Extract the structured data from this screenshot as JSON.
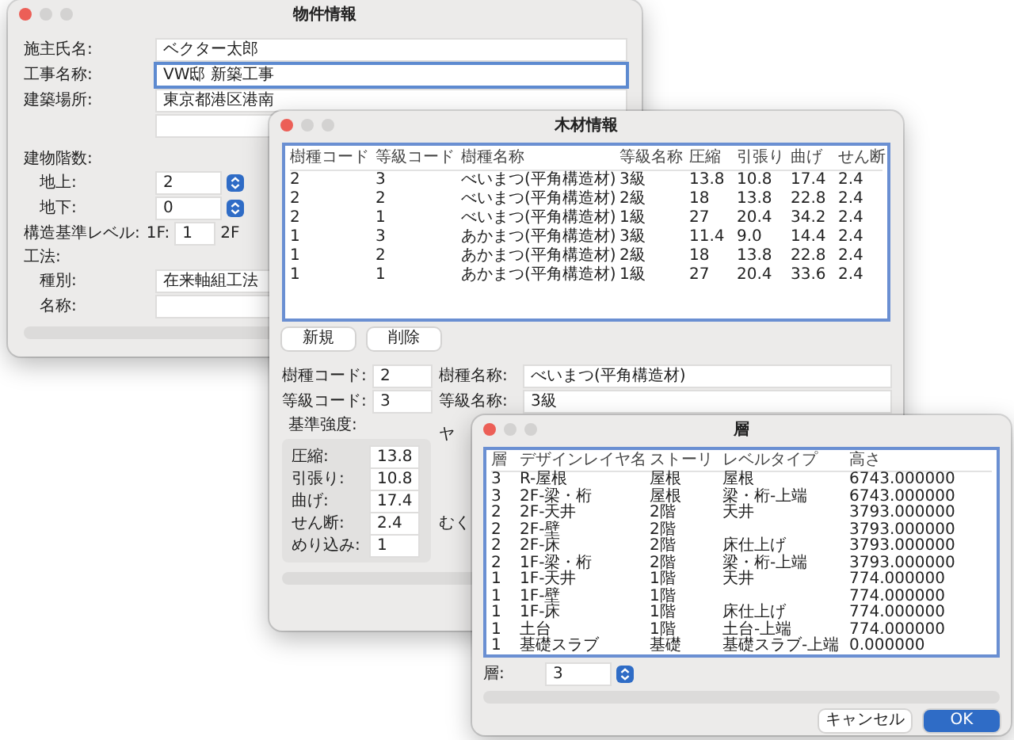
{
  "property_window": {
    "title": "物件情報",
    "fields": [
      {
        "label": "施主氏名:",
        "value": "ベクター太郎",
        "focused": false
      },
      {
        "label": "工事名称:",
        "value": "VW邸 新築工事",
        "focused": true
      },
      {
        "label": "建築場所:",
        "value": "東京都港区港南",
        "focused": false
      }
    ],
    "extra_address_line": true,
    "floors": {
      "heading": "建物階数:",
      "above": {
        "label": "地上:",
        "value": "2"
      },
      "below": {
        "label": "地下:",
        "value": "0"
      }
    },
    "structural_level": {
      "label": "構造基準レベル:",
      "levels": [
        {
          "label": "1F:",
          "value": "1"
        },
        {
          "label": "2F"
        }
      ]
    },
    "method": {
      "heading": "工法:",
      "type": {
        "label": "種別:",
        "value": "在来軸組工法"
      },
      "name": {
        "label": "名称:"
      }
    }
  },
  "timber_window": {
    "title": "木材情報",
    "table": {
      "columns": [
        "樹種コード",
        "等級コード",
        "樹種名称",
        "等級名称",
        "圧縮",
        "引張り",
        "曲げ",
        "せん断"
      ],
      "rows": [
        [
          "2",
          "3",
          "べいまつ(平角構造材)",
          "3級",
          "13.8",
          "10.8",
          "17.4",
          "2.4"
        ],
        [
          "2",
          "2",
          "べいまつ(平角構造材)",
          "2級",
          "18",
          "13.8",
          "22.8",
          "2.4"
        ],
        [
          "2",
          "1",
          "べいまつ(平角構造材)",
          "1級",
          "27",
          "20.4",
          "34.2",
          "2.4"
        ],
        [
          "1",
          "3",
          "あかまつ(平角構造材)",
          "3級",
          "11.4",
          "9.0",
          "14.4",
          "2.4"
        ],
        [
          "1",
          "2",
          "あかまつ(平角構造材)",
          "2級",
          "18",
          "13.8",
          "22.8",
          "2.4"
        ],
        [
          "1",
          "1",
          "あかまつ(平角構造材)",
          "1級",
          "27",
          "20.4",
          "33.6",
          "2.4"
        ]
      ]
    },
    "buttons": [
      "新規",
      "削除"
    ],
    "code_fields": [
      {
        "label": "樹種コード:",
        "value": "2"
      },
      {
        "label": "等級コード:",
        "value": "3"
      }
    ],
    "name_fields": [
      {
        "label": "樹種名称:",
        "value": "べいまつ(平角構造材)"
      },
      {
        "label": "等級名称:",
        "value": "3級"
      }
    ],
    "strength": {
      "heading": "基準強度:",
      "rows": [
        {
          "label": "圧縮:",
          "value": "13.8"
        },
        {
          "label": "引張り:",
          "value": "10.8"
        },
        {
          "label": "曲げ:",
          "value": "17.4"
        },
        {
          "label": "せん断:",
          "value": "2.4"
        },
        {
          "label": "めり込み:",
          "value": "1"
        }
      ]
    },
    "partial_labels": [
      "ヤ",
      "むく"
    ]
  },
  "layer_window": {
    "title": "層",
    "table": {
      "columns": [
        "層",
        "デザインレイヤ名",
        "ストーリ",
        "レベルタイプ",
        "高さ"
      ],
      "rows": [
        [
          "3",
          "R-屋根",
          "屋根",
          "屋根",
          "6743.000000"
        ],
        [
          "3",
          "2F-梁・桁",
          "屋根",
          "梁・桁-上端",
          "6743.000000"
        ],
        [
          "2",
          "2F-天井",
          "2階",
          "天井",
          "3793.000000"
        ],
        [
          "2",
          "2F-壁",
          "2階",
          null,
          "3793.000000"
        ],
        [
          "2",
          "2F-床",
          "2階",
          "床仕上げ",
          "3793.000000"
        ],
        [
          "2",
          "1F-梁・桁",
          "2階",
          "梁・桁-上端",
          "3793.000000"
        ],
        [
          "1",
          "1F-天井",
          "1階",
          "天井",
          "774.000000"
        ],
        [
          "1",
          "1F-壁",
          "1階",
          null,
          "774.000000"
        ],
        [
          "1",
          "1F-床",
          "1階",
          "床仕上げ",
          "774.000000"
        ],
        [
          "1",
          "土台",
          "1階",
          "土台-上端",
          "774.000000"
        ],
        [
          "1",
          "基礎スラブ",
          "基礎",
          "基礎スラブ-上端",
          "0.000000"
        ]
      ]
    },
    "layer_select": {
      "label": "層:",
      "value": "3"
    },
    "buttons": [
      {
        "label": "キャンセル",
        "kind": "secondary"
      },
      {
        "label": "OK",
        "kind": "primary"
      }
    ]
  }
}
